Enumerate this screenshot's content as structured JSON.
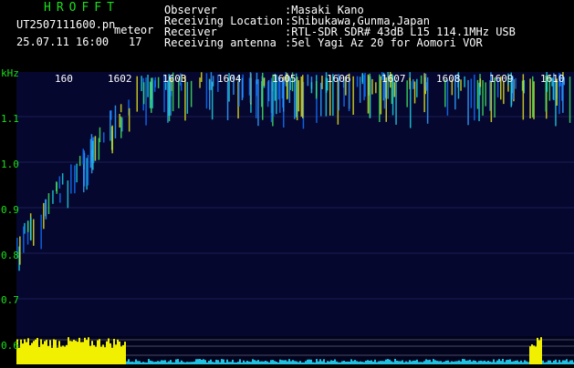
{
  "header": {
    "app_title": "HROFFT",
    "file_name": "UT2507111600.pn",
    "date_time": "25.07.11 16:00",
    "count_label": "meteor",
    "count_value": "17"
  },
  "info": [
    {
      "key": "Observer",
      "value": ":Masaki Kano"
    },
    {
      "key": "Receiving Location",
      "value": ":Shibukawa,Gunma,Japan"
    },
    {
      "key": "Receiver",
      "value": ":RTL-SDR SDR# 43dB L15 114.1MHz USB"
    },
    {
      "key": "Receiving antenna",
      "value": ":5el Yagi Az 20 for Aomori VOR"
    }
  ],
  "axis": {
    "y_unit": "kHz",
    "y_ticks": [
      "1.1",
      "1.0",
      "0.9",
      "0.8",
      "0.7",
      "0.6"
    ],
    "x_ticks": [
      "160",
      "1602",
      "1603",
      "1604",
      "1605",
      "1606",
      "1607",
      "1608",
      "1609",
      "1610"
    ]
  },
  "colors": {
    "text_green": "#19e019",
    "text_white": "#ffffff",
    "background": "#05072e",
    "signal_yellow": "#f0f000",
    "signal_cyan": "#20d0e0"
  }
}
